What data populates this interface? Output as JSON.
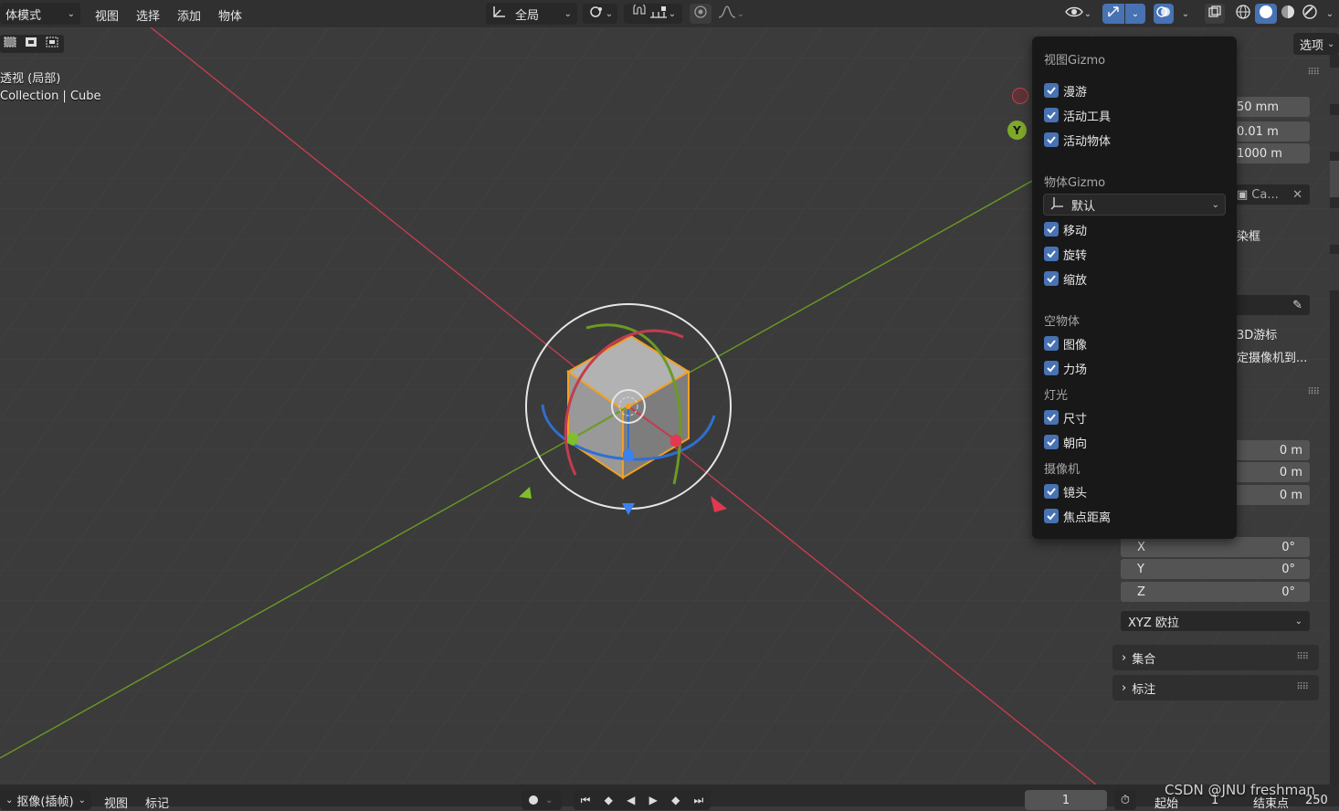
{
  "header": {
    "mode_label": "体模式",
    "menu": [
      "视图",
      "选择",
      "添加",
      "物体"
    ],
    "transform_orientation": "全局",
    "options_label": "选项"
  },
  "viewport": {
    "view_label": "透视 (局部)",
    "collection_label": "Collection | Cube",
    "nav_gizmo_y": "Y"
  },
  "popover": {
    "viewport_gizmos_title": "视图Gizmo",
    "viewport_gizmos": [
      "漫游",
      "活动工具",
      "活动物体"
    ],
    "object_gizmos_title": "物体Gizmo",
    "object_gizmo_orientation": "默认",
    "object_gizmos": [
      "移动",
      "旋转",
      "缩放"
    ],
    "empty_title": "空物体",
    "empty_items": [
      "图像",
      "力场"
    ],
    "light_title": "灯光",
    "light_items": [
      "尺寸",
      "朝向"
    ],
    "camera_title": "摄像机",
    "camera_items": [
      "镜头",
      "焦点距离"
    ]
  },
  "sidebar": {
    "focal_length": "50 mm",
    "clip_start": "0.01 m",
    "clip_end": "1000 m",
    "local_camera": "Ca...",
    "render_region": "染框",
    "cursor_label": "3D游标",
    "lock_camera": "定摄像机到...",
    "location": [
      "0 m",
      "0 m",
      "0 m"
    ],
    "rotation_axes": [
      "X",
      "Y",
      "Z"
    ],
    "rotation_values": [
      "0°",
      "0°",
      "0°"
    ],
    "rotation_mode": "XYZ 欧拉",
    "collections_panel": "集合",
    "annotations_panel": "标注"
  },
  "timeline": {
    "playback_label": "抠像(插帧)",
    "view": "视图",
    "marker": "标记",
    "current_frame": "1",
    "start_label": "起始",
    "start_value": "1",
    "end_label": "结束点",
    "end_value": "250"
  },
  "watermark": "CSDN @JNU freshman",
  "colors": {
    "accent": "#4772b3",
    "x_axis": "#c43c4f",
    "y_axis": "#6b9a23",
    "z_axis": "#2f6fd0",
    "selection": "#f2a024"
  }
}
